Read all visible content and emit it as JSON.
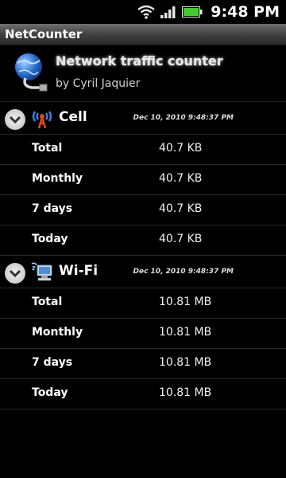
{
  "status": {
    "time": "9:48 PM"
  },
  "app": {
    "bar_title": "NetCounter"
  },
  "header": {
    "title": "Network traffic counter",
    "author": "by Cyril Jaquier"
  },
  "sections": [
    {
      "title": "Cell",
      "icon": "antenna-icon",
      "date": "Dec 10, 2010 9:48:37 PM",
      "rows": [
        {
          "label": "Total",
          "value": "40.7 KB"
        },
        {
          "label": "Monthly",
          "value": "40.7 KB"
        },
        {
          "label": "7 days",
          "value": "40.7 KB"
        },
        {
          "label": "Today",
          "value": "40.7 KB"
        }
      ]
    },
    {
      "title": "Wi-Fi",
      "icon": "wifi-computer-icon",
      "date": "Dec 10, 2010 9:48:37 PM",
      "rows": [
        {
          "label": "Total",
          "value": "10.81 MB"
        },
        {
          "label": "Monthly",
          "value": "10.81 MB"
        },
        {
          "label": "7 days",
          "value": "10.81 MB"
        },
        {
          "label": "Today",
          "value": "10.81 MB"
        }
      ]
    }
  ]
}
